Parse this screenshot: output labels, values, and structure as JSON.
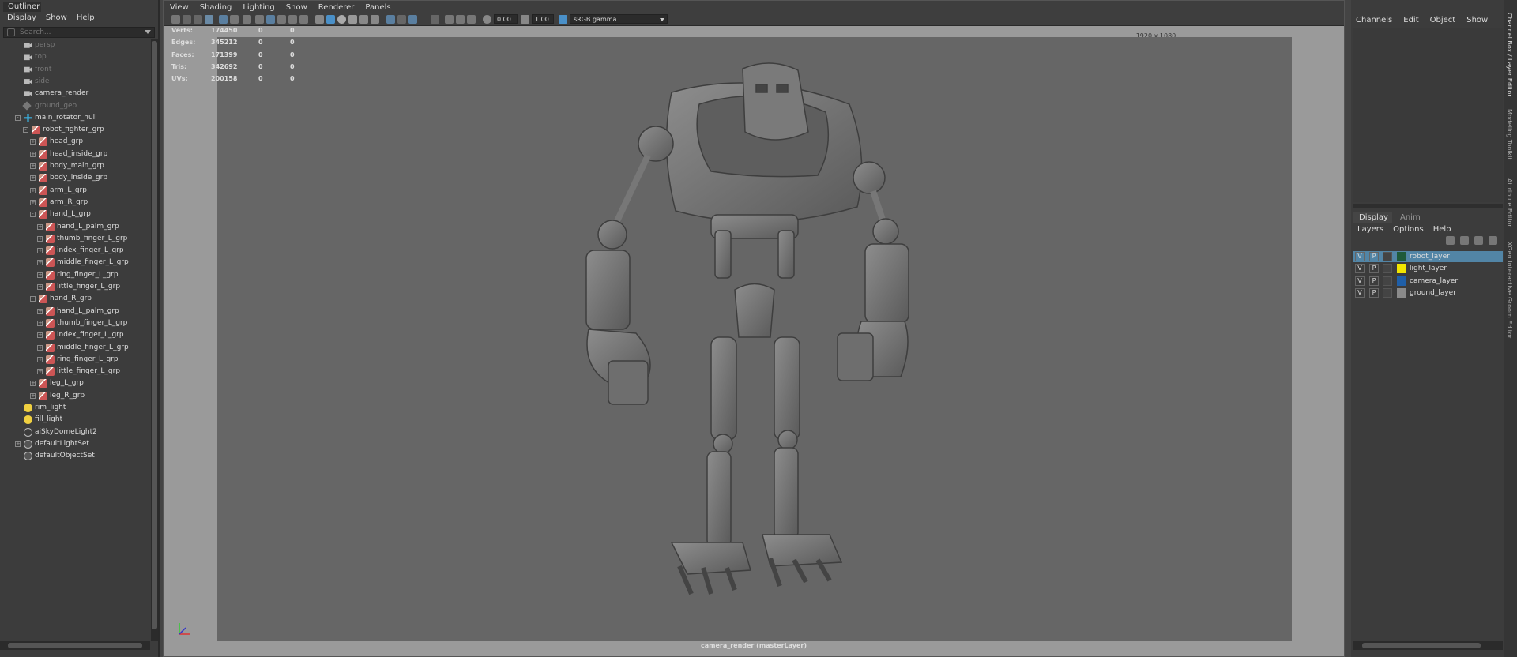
{
  "outliner": {
    "tab": "Outliner",
    "menu": [
      "Display",
      "Show",
      "Help"
    ],
    "search_placeholder": "Search...",
    "items": [
      {
        "label": "persp",
        "dim": true,
        "indent": 30,
        "icon": "camera"
      },
      {
        "label": "top",
        "dim": true,
        "indent": 30,
        "icon": "camera"
      },
      {
        "label": "front",
        "dim": true,
        "indent": 30,
        "icon": "camera"
      },
      {
        "label": "side",
        "dim": true,
        "indent": 30,
        "icon": "camera"
      },
      {
        "label": "camera_render",
        "dim": false,
        "indent": 30,
        "icon": "camera"
      },
      {
        "label": "ground_geo",
        "dim": true,
        "indent": 30,
        "icon": "mesh"
      },
      {
        "label": "main_rotator_null",
        "dim": false,
        "indent": 30,
        "icon": "null",
        "expander": "-"
      },
      {
        "label": "robot_fighter_grp",
        "dim": false,
        "indent": 40,
        "icon": "group",
        "expander": "-"
      },
      {
        "label": "head_grp",
        "dim": false,
        "indent": 49,
        "icon": "group",
        "expander": "+"
      },
      {
        "label": "head_inside_grp",
        "dim": false,
        "indent": 49,
        "icon": "group",
        "expander": "+"
      },
      {
        "label": "body_main_grp",
        "dim": false,
        "indent": 49,
        "icon": "group",
        "expander": "+"
      },
      {
        "label": "body_inside_grp",
        "dim": false,
        "indent": 49,
        "icon": "group",
        "expander": "+"
      },
      {
        "label": "arm_L_grp",
        "dim": false,
        "indent": 49,
        "icon": "group",
        "expander": "+"
      },
      {
        "label": "arm_R_grp",
        "dim": false,
        "indent": 49,
        "icon": "group",
        "expander": "+"
      },
      {
        "label": "hand_L_grp",
        "dim": false,
        "indent": 49,
        "icon": "group",
        "expander": "-"
      },
      {
        "label": "hand_L_palm_grp",
        "dim": false,
        "indent": 58,
        "icon": "group",
        "expander": "+"
      },
      {
        "label": "thumb_finger_L_grp",
        "dim": false,
        "indent": 58,
        "icon": "group",
        "expander": "+"
      },
      {
        "label": "index_finger_L_grp",
        "dim": false,
        "indent": 58,
        "icon": "group",
        "expander": "+"
      },
      {
        "label": "middle_finger_L_grp",
        "dim": false,
        "indent": 58,
        "icon": "group",
        "expander": "+"
      },
      {
        "label": "ring_finger_L_grp",
        "dim": false,
        "indent": 58,
        "icon": "group",
        "expander": "+"
      },
      {
        "label": "little_finger_L_grp",
        "dim": false,
        "indent": 58,
        "icon": "group",
        "expander": "+"
      },
      {
        "label": "hand_R_grp",
        "dim": false,
        "indent": 49,
        "icon": "group",
        "expander": "-"
      },
      {
        "label": "hand_L_palm_grp",
        "dim": false,
        "indent": 58,
        "icon": "group",
        "expander": "+"
      },
      {
        "label": "thumb_finger_L_grp",
        "dim": false,
        "indent": 58,
        "icon": "group",
        "expander": "+"
      },
      {
        "label": "index_finger_L_grp",
        "dim": false,
        "indent": 58,
        "icon": "group",
        "expander": "+"
      },
      {
        "label": "middle_finger_L_grp",
        "dim": false,
        "indent": 58,
        "icon": "group",
        "expander": "+"
      },
      {
        "label": "ring_finger_L_grp",
        "dim": false,
        "indent": 58,
        "icon": "group",
        "expander": "+"
      },
      {
        "label": "little_finger_L_grp",
        "dim": false,
        "indent": 58,
        "icon": "group",
        "expander": "+"
      },
      {
        "label": "leg_L_grp",
        "dim": false,
        "indent": 49,
        "icon": "group",
        "expander": "+"
      },
      {
        "label": "leg_R_grp",
        "dim": false,
        "indent": 49,
        "icon": "group",
        "expander": "+"
      },
      {
        "label": "rim_light",
        "dim": false,
        "indent": 30,
        "icon": "light"
      },
      {
        "label": "fill_light",
        "dim": false,
        "indent": 30,
        "icon": "light"
      },
      {
        "label": "aiSkyDomeLight2",
        "dim": false,
        "indent": 30,
        "icon": "dome"
      },
      {
        "label": "defaultLightSet",
        "dim": false,
        "indent": 30,
        "icon": "set",
        "expander": "+"
      },
      {
        "label": "defaultObjectSet",
        "dim": false,
        "indent": 30,
        "icon": "set"
      }
    ]
  },
  "viewport": {
    "menu": [
      "View",
      "Shading",
      "Lighting",
      "Show",
      "Renderer",
      "Panels"
    ],
    "exposure": "0.00",
    "gamma": "1.00",
    "color_space": "sRGB gamma",
    "resolution_gate": "1920 x 1080",
    "camera_label": "camera_render (masterLayer)",
    "hud": [
      {
        "label": "Verts:",
        "v1": "174450",
        "v2": "0",
        "v3": "0"
      },
      {
        "label": "Edges:",
        "v1": "345212",
        "v2": "0",
        "v3": "0"
      },
      {
        "label": "Faces:",
        "v1": "171399",
        "v2": "0",
        "v3": "0"
      },
      {
        "label": "Tris:",
        "v1": "342692",
        "v2": "0",
        "v3": "0"
      },
      {
        "label": "UVs:",
        "v1": "200158",
        "v2": "0",
        "v3": "0"
      }
    ]
  },
  "channel_box": {
    "menu": [
      "Channels",
      "Edit",
      "Object",
      "Show"
    ]
  },
  "layer_editor": {
    "tabs": [
      "Display",
      "Anim"
    ],
    "menu": [
      "Layers",
      "Options",
      "Help"
    ],
    "layers": [
      {
        "v": "V",
        "p": "P",
        "name": "robot_layer",
        "color": "#1f5a3a",
        "selected": true
      },
      {
        "v": "V",
        "p": "P",
        "name": "light_layer",
        "color": "#f2e600",
        "selected": false
      },
      {
        "v": "V",
        "p": "P",
        "name": "camera_layer",
        "color": "#1f5fa8",
        "selected": false
      },
      {
        "v": "V",
        "p": "P",
        "name": "ground_layer",
        "color": "#8a8a8a",
        "selected": false
      }
    ]
  },
  "side_tabs": [
    "Channel Box / Layer Editor",
    "Modeling Toolkit",
    "Attribute Editor",
    "XGen Interactive Groom Editor"
  ]
}
